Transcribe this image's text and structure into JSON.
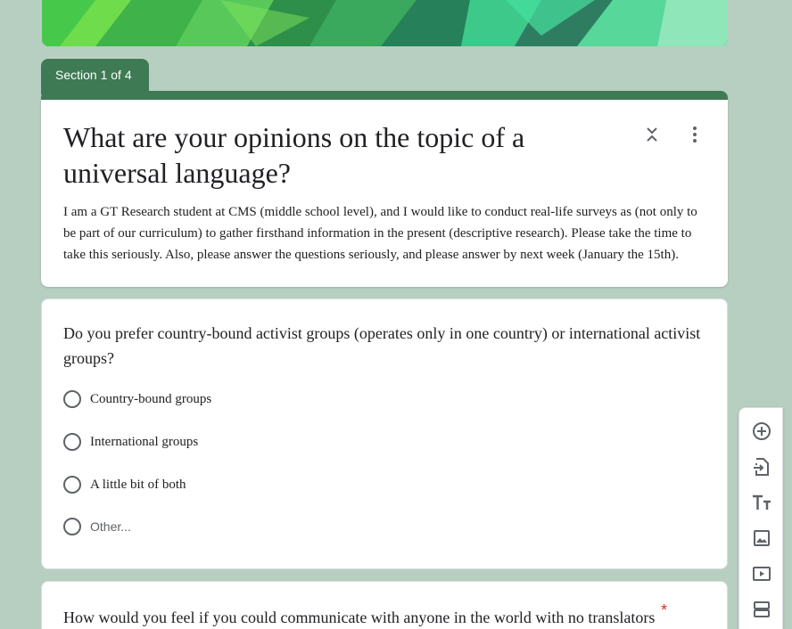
{
  "header": {
    "section_tab": "Section 1 of 4"
  },
  "form": {
    "title": "What are your opinions on the topic of a universal language?",
    "description": "I am a GT Research student at CMS (middle school level), and I would like to conduct real-life surveys as (not only to be part of our curriculum) to gather firsthand information in the present (descriptive research). Please take the time to take this seriously. Also, please answer the questions seriously, and please answer by next week (January the 15th).",
    "accent_color": "#3e7a54"
  },
  "questions": [
    {
      "title": "Do you prefer country-bound activist groups (operates only in one country) or international activist groups?",
      "options": [
        "Country-bound groups",
        "International groups",
        "A little bit of both"
      ],
      "other_label": "Other..."
    },
    {
      "title": "How would you feel if you could communicate with anyone in the world with no translators",
      "required_mark": "*"
    }
  ],
  "toolbar": {
    "icons": [
      "add-question-icon",
      "import-questions-icon",
      "add-title-icon",
      "add-image-icon",
      "add-video-icon",
      "add-section-icon"
    ]
  }
}
